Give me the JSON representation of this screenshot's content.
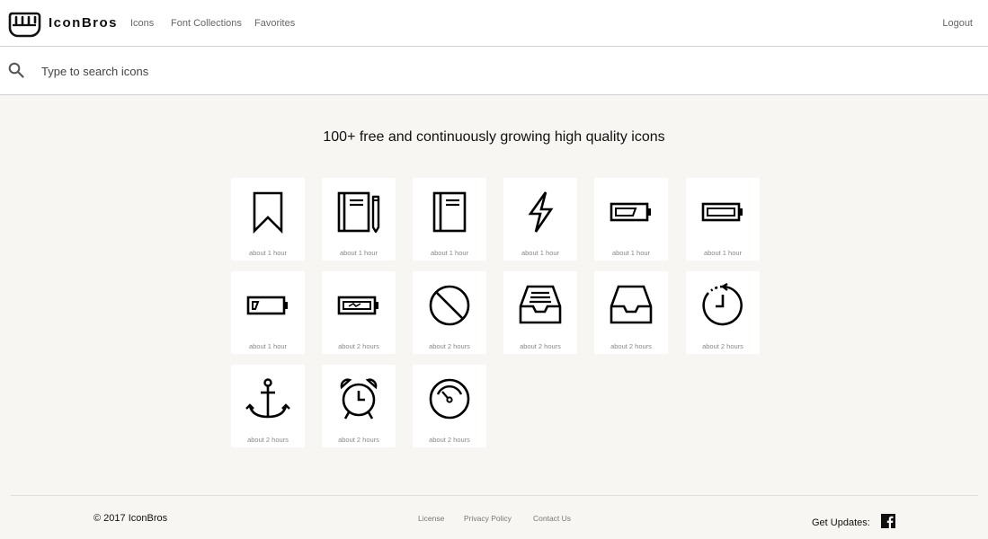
{
  "header": {
    "brand": "IconBros",
    "nav": [
      {
        "label": "Icons"
      },
      {
        "label": "Font Collections"
      },
      {
        "label": "Favorites"
      }
    ],
    "logout": "Logout",
    "logo_icon": "fist-logo-icon"
  },
  "search": {
    "placeholder": "Type to search icons",
    "icon": "search-icon"
  },
  "headline": "100+ free and continuously growing high quality icons",
  "icons": [
    {
      "name": "bookmark-icon",
      "time": "about 1 hour"
    },
    {
      "name": "notebook-pencil-icon",
      "time": "about 1 hour"
    },
    {
      "name": "notebook-icon",
      "time": "about 1 hour"
    },
    {
      "name": "lightning-icon",
      "time": "about 1 hour"
    },
    {
      "name": "battery-half-icon",
      "time": "about 1 hour"
    },
    {
      "name": "battery-full-icon",
      "time": "about 1 hour"
    },
    {
      "name": "battery-low-icon",
      "time": "about 1 hour"
    },
    {
      "name": "battery-charging-icon",
      "time": "about 2 hours"
    },
    {
      "name": "forbidden-icon",
      "time": "about 2 hours"
    },
    {
      "name": "inbox-full-icon",
      "time": "about 2 hours"
    },
    {
      "name": "inbox-empty-icon",
      "time": "about 2 hours"
    },
    {
      "name": "clock-history-icon",
      "time": "about 2 hours"
    },
    {
      "name": "anchor-icon",
      "time": "about 2 hours"
    },
    {
      "name": "alarm-clock-icon",
      "time": "about 2 hours"
    },
    {
      "name": "gauge-icon",
      "time": "about 2 hours"
    }
  ],
  "footer": {
    "copyright": "© 2017 IconBros",
    "links": [
      {
        "label": "License"
      },
      {
        "label": "Privacy Policy"
      },
      {
        "label": "Contact Us"
      }
    ],
    "get_updates": "Get Updates:",
    "social_icon": "facebook-icon"
  },
  "colors": {
    "background": "#f8f6f3",
    "card": "#ffffff",
    "icon_stroke": "#000000"
  }
}
